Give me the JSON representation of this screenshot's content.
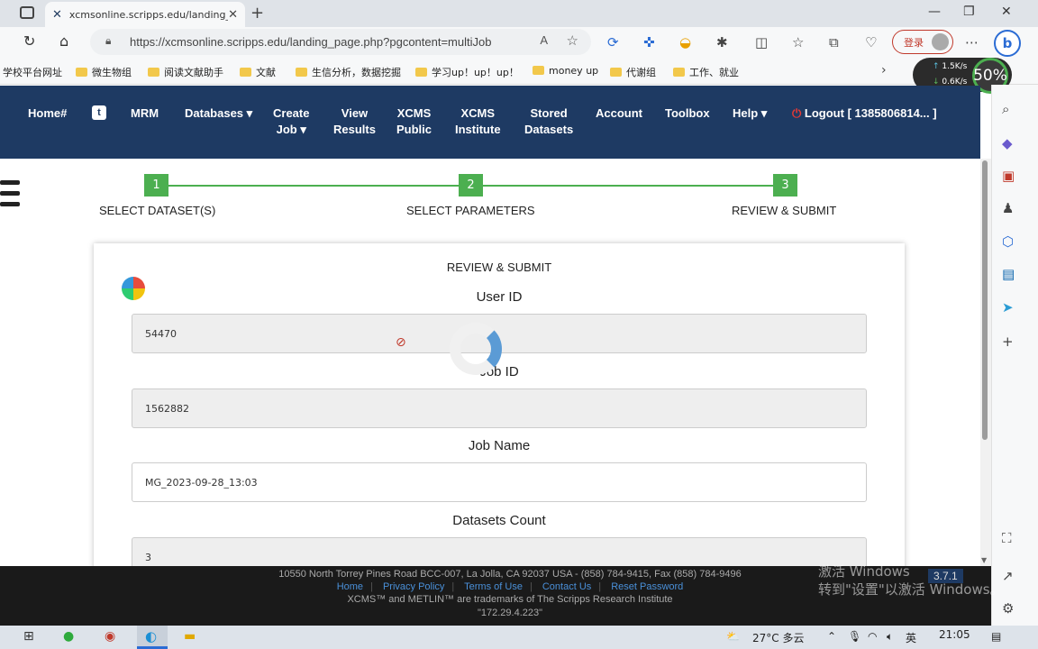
{
  "browser": {
    "tab_title": "xcmsonline.scripps.edu/landing_p",
    "url": "https://xcmsonline.scripps.edu/landing_page.php?pgcontent=multiJob",
    "login_label": "登录",
    "bookmarks": [
      "学校平台网址",
      "微生物组",
      "阅读文献助手",
      "文献",
      "生信分析，数据挖掘",
      "学习up！up！up！",
      "money up",
      "代谢组",
      "工作、就业"
    ]
  },
  "network": {
    "up": "1.5K/s",
    "down": "0.6K/s",
    "percent": "50%"
  },
  "nav": {
    "home": "Home#",
    "mrm": "MRM",
    "databases": "Databases ▾",
    "create_job_1": "Create",
    "create_job_2": "Job ▾",
    "view_results_1": "View",
    "view_results_2": "Results",
    "xcms_public_1": "XCMS",
    "xcms_public_2": "Public",
    "xcms_institute_1": "XCMS",
    "xcms_institute_2": "Institute",
    "stored_datasets_1": "Stored",
    "stored_datasets_2": "Datasets",
    "account": "Account",
    "toolbox": "Toolbox",
    "help": "Help ▾",
    "logout": "Logout [ 1385806814... ]"
  },
  "steps": [
    {
      "num": "1",
      "label": "SELECT DATASET(S)"
    },
    {
      "num": "2",
      "label": "SELECT PARAMETERS"
    },
    {
      "num": "3",
      "label": "REVIEW & SUBMIT"
    }
  ],
  "form": {
    "title": "REVIEW & SUBMIT",
    "user_id_label": "User ID",
    "user_id": "54470",
    "job_id_label": "Job ID",
    "job_id": "1562882",
    "job_name_label": "Job Name",
    "job_name": "MG_2023-09-28_13:03",
    "datasets_count_label": "Datasets Count",
    "datasets_count": "3"
  },
  "footer": {
    "address": "10550 North Torrey Pines Road BCC-007, La Jolla, CA 92037 USA - (858) 784-9415, Fax (858) 784-9496",
    "links": [
      "Home",
      "Privacy Policy",
      "Terms of Use",
      "Contact Us",
      "Reset Password"
    ],
    "trademark": "XCMS™ and METLIN™ are trademarks of The Scripps Research Institute",
    "ip": "\"172.29.4.223\"",
    "version": "3.7.1"
  },
  "watermark": {
    "line1": "激活 Windows",
    "line2": "转到\"设置\"以激活 Windows。"
  },
  "taskbar": {
    "weather": "27°C 多云",
    "ime": "英",
    "time": "21:05"
  }
}
